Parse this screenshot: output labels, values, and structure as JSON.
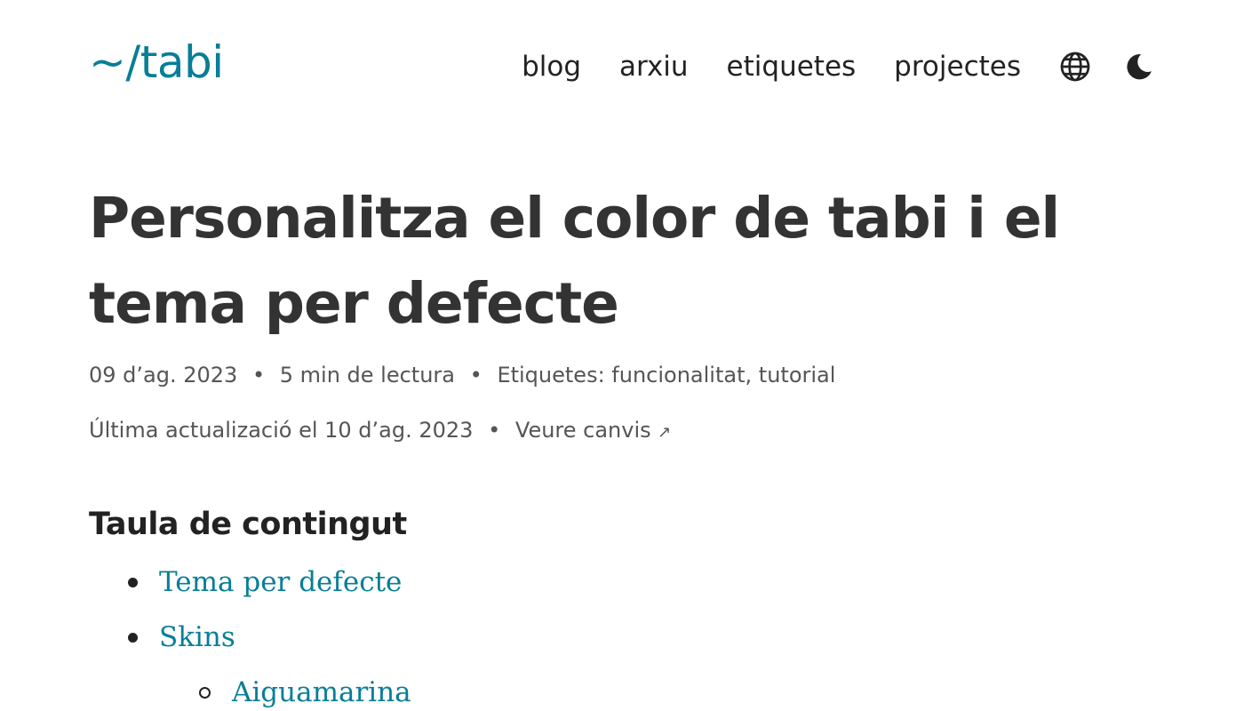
{
  "header": {
    "logo": "~/tabi",
    "nav": [
      {
        "label": "blog"
      },
      {
        "label": "arxiu"
      },
      {
        "label": "etiquetes"
      },
      {
        "label": "projectes"
      }
    ],
    "icons": {
      "language": "globe-icon",
      "theme": "moon-icon"
    }
  },
  "article": {
    "title": "Personalitza el color de tabi i el tema per defecte",
    "meta": {
      "date": "09 d’ag. 2023",
      "separator": "•",
      "reading_time": "5 min de lectura",
      "tags_label": "Etiquetes:",
      "tags": [
        "funcionalitat",
        "tutorial"
      ],
      "tags_joiner": ","
    },
    "update": {
      "text": "Última actualizació el 10 d’ag. 2023",
      "changes_link": "Veure canvis",
      "external_glyph": "↗"
    }
  },
  "toc": {
    "title": "Taula de contingut",
    "items": [
      {
        "label": "Tema per defecte",
        "level": 1
      },
      {
        "label": "Skins",
        "level": 1
      },
      {
        "label": "Aiguamarina",
        "level": 2
      }
    ]
  },
  "colors": {
    "accent": "#087e96",
    "text": "#222222",
    "title": "#333333",
    "meta": "#555555"
  }
}
